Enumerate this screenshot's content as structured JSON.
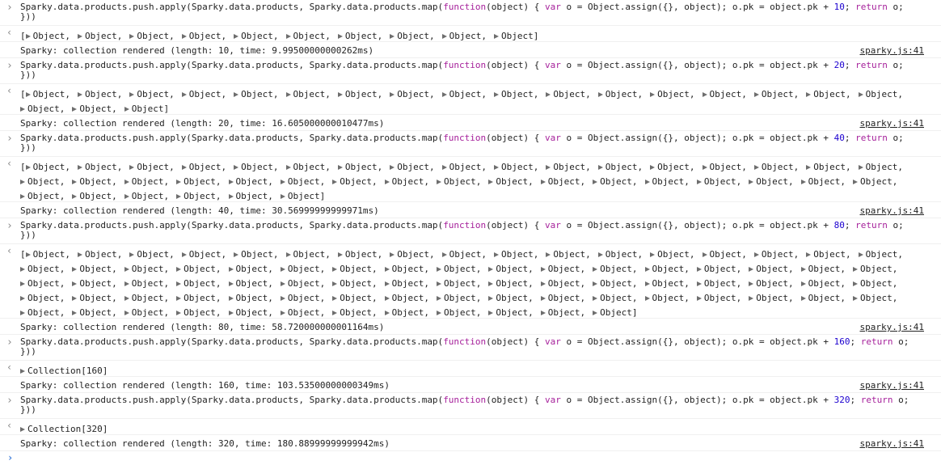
{
  "commands": [
    {
      "head": "Sparky.data.products.push.apply(Sparky.data.products, Sparky.data.products.map(",
      "kw1": "function",
      "mid": "(object) { ",
      "kw2": "var",
      "mid2": " o = Object.assign({}, object); o.pk = object.pk + ",
      "num": "10",
      "sc": "; ",
      "kw3": "return",
      "tail": " o;",
      "line2": "}))"
    },
    {
      "head": "Sparky.data.products.push.apply(Sparky.data.products, Sparky.data.products.map(",
      "kw1": "function",
      "mid": "(object) { ",
      "kw2": "var",
      "mid2": " o = Object.assign({}, object); o.pk = object.pk + ",
      "num": "20",
      "sc": "; ",
      "kw3": "return",
      "tail": " o;",
      "line2": "}))"
    },
    {
      "head": "Sparky.data.products.push.apply(Sparky.data.products, Sparky.data.products.map(",
      "kw1": "function",
      "mid": "(object) { ",
      "kw2": "var",
      "mid2": " o = Object.assign({}, object); o.pk = object.pk + ",
      "num": "40",
      "sc": "; ",
      "kw3": "return",
      "tail": " o;",
      "line2": "}))"
    },
    {
      "head": "Sparky.data.products.push.apply(Sparky.data.products, Sparky.data.products.map(",
      "kw1": "function",
      "mid": "(object) { ",
      "kw2": "var",
      "mid2": " o = Object.assign({}, object); o.pk = object.pk + ",
      "num": "80",
      "sc": "; ",
      "kw3": "return",
      "tail": " o;",
      "line2": "}))"
    },
    {
      "head": "Sparky.data.products.push.apply(Sparky.data.products, Sparky.data.products.map(",
      "kw1": "function",
      "mid": "(object) { ",
      "kw2": "var",
      "mid2": " o = Object.assign({}, object); o.pk = object.pk + ",
      "num": "160",
      "sc": "; ",
      "kw3": "return",
      "tail": " o;",
      "line2": "}))"
    },
    {
      "head": "Sparky.data.products.push.apply(Sparky.data.products, Sparky.data.products.map(",
      "kw1": "function",
      "mid": "(object) { ",
      "kw2": "var",
      "mid2": " o = Object.assign({}, object); o.pk = object.pk + ",
      "num": "320",
      "sc": "; ",
      "kw3": "return",
      "tail": " o;",
      "line2": "}))"
    }
  ],
  "results": [
    {
      "type": "array",
      "count": 10
    },
    {
      "type": "array",
      "count": 20
    },
    {
      "type": "array",
      "count": 40
    },
    {
      "type": "array",
      "count": 80
    },
    {
      "type": "collection",
      "label": "Collection[160]"
    },
    {
      "type": "collection",
      "label": "Collection[320]"
    }
  ],
  "object_label": "Object",
  "logs": [
    {
      "text": "Sparky: collection rendered (length: 10, time: 9.99500000000262ms)",
      "source": "sparky.js:41"
    },
    {
      "text": "Sparky: collection rendered (length: 20, time: 16.605000000010477ms)",
      "source": "sparky.js:41"
    },
    {
      "text": "Sparky: collection rendered (length: 40, time: 30.56999999999971ms)",
      "source": "sparky.js:41"
    },
    {
      "text": "Sparky: collection rendered (length: 80, time: 58.720000000001164ms)",
      "source": "sparky.js:41"
    },
    {
      "text": "Sparky: collection rendered (length: 160, time: 103.53500000000349ms)",
      "source": "sparky.js:41"
    },
    {
      "text": "Sparky: collection rendered (length: 320, time: 180.88999999999942ms)",
      "source": "sparky.js:41"
    }
  ],
  "icons": {
    "input_prompt": "chevron-right-icon",
    "output_prompt": "return-arrow-icon",
    "expand": "disclosure-triangle-icon"
  },
  "colors": {
    "keyword": "#a6219b",
    "number": "#1c00cf",
    "prompt_active": "#3879d9",
    "link": "#222222"
  }
}
